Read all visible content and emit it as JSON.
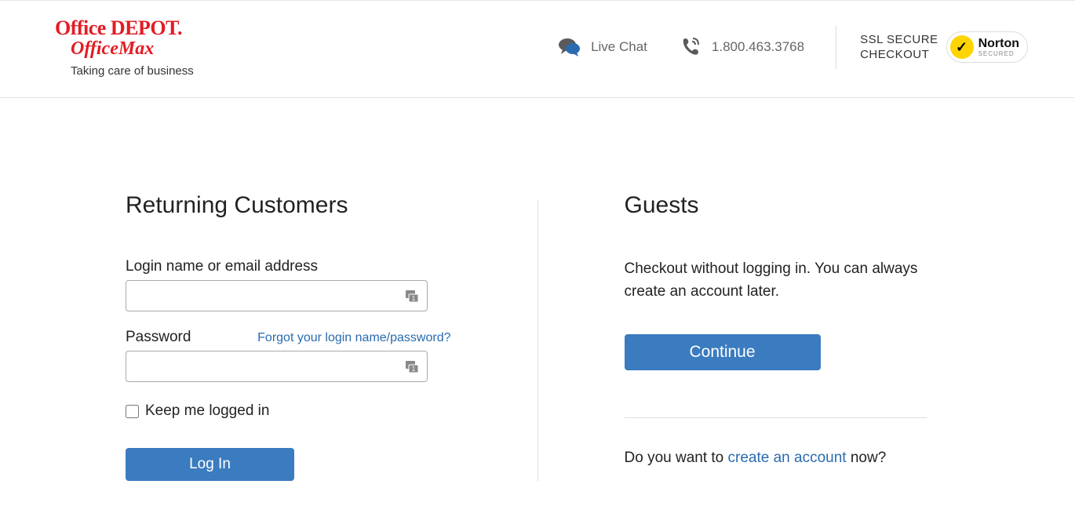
{
  "header": {
    "logo_line1": "Office DEPOT.",
    "logo_line2": "OfficeMax",
    "logo_tagline": "Taking care of business",
    "live_chat": "Live Chat",
    "phone": "1.800.463.3768",
    "secure_line1": "SSL SECURE",
    "secure_line2": "CHECKOUT",
    "norton_brand": "Norton",
    "norton_sub": "SECURED"
  },
  "returning": {
    "heading": "Returning Customers",
    "login_label": "Login name or email address",
    "password_label": "Password",
    "forgot": "Forgot your login name/password?",
    "keep_logged": "Keep me logged in",
    "login_button": "Log In",
    "login_value": "",
    "password_value": ""
  },
  "guests": {
    "heading": "Guests",
    "text": "Checkout without logging in. You can always create an account later.",
    "continue_button": "Continue",
    "create_prefix": "Do you want to ",
    "create_link": "create an account",
    "create_suffix": " now?"
  }
}
